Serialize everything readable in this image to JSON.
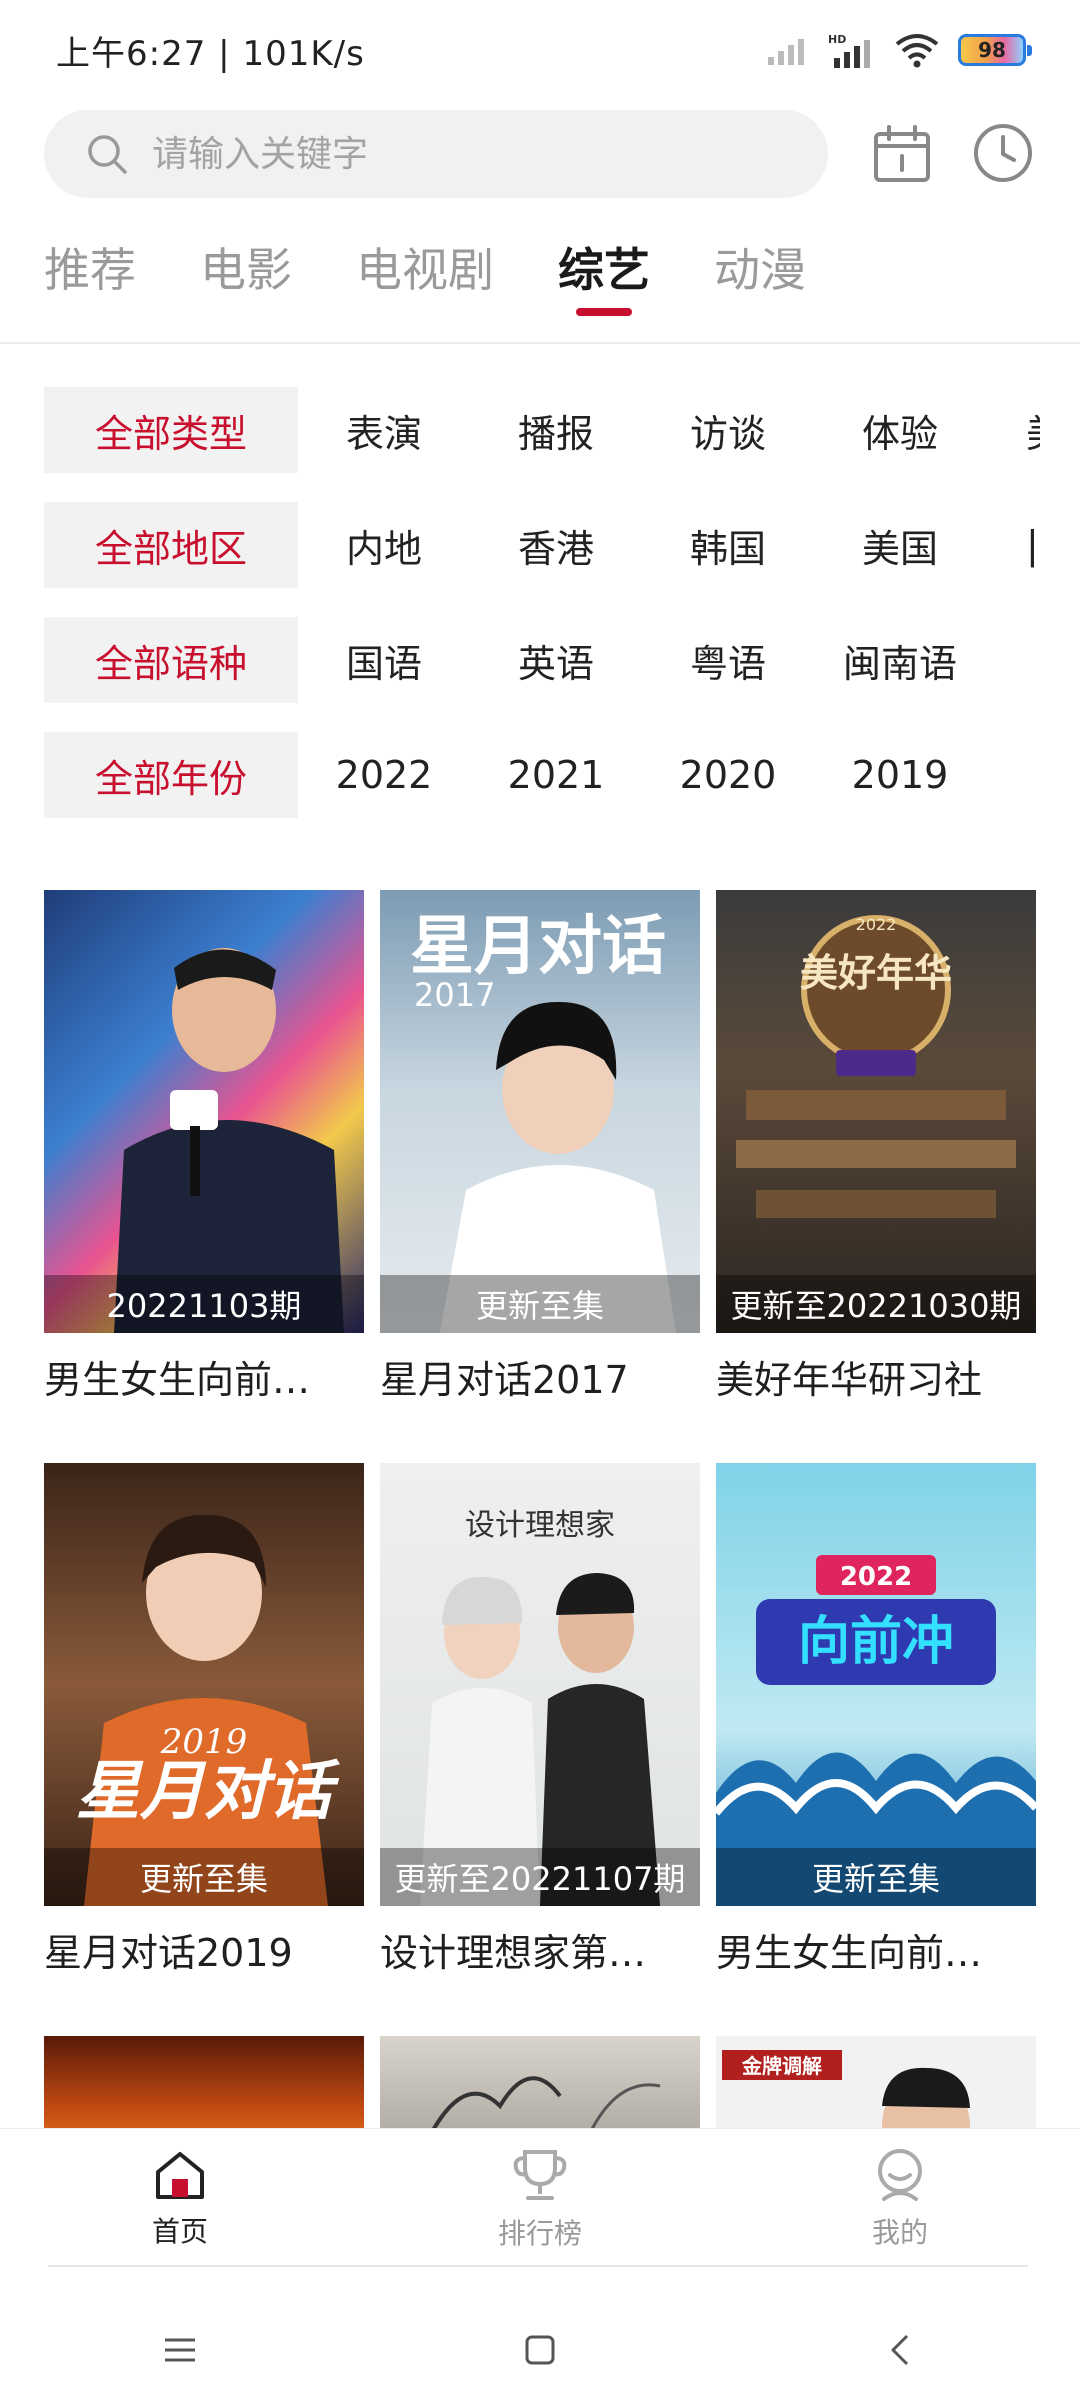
{
  "status": {
    "time": "上午6:27",
    "speed": "101K/s",
    "network_label": "HD",
    "battery": "98"
  },
  "search": {
    "placeholder": "请输入关键字"
  },
  "tabs": [
    {
      "label": "推荐",
      "active": false
    },
    {
      "label": "电影",
      "active": false
    },
    {
      "label": "电视剧",
      "active": false
    },
    {
      "label": "综艺",
      "active": true
    },
    {
      "label": "动漫",
      "active": false
    }
  ],
  "filters": [
    {
      "all": "全部类型",
      "options": [
        "表演",
        "播报",
        "访谈",
        "体验",
        "美"
      ]
    },
    {
      "all": "全部地区",
      "options": [
        "内地",
        "香港",
        "韩国",
        "美国",
        "|"
      ]
    },
    {
      "all": "全部语种",
      "options": [
        "国语",
        "英语",
        "粤语",
        "闽南语"
      ]
    },
    {
      "all": "全部年份",
      "options": [
        "2022",
        "2021",
        "2020",
        "2019"
      ]
    }
  ],
  "cards": [
    {
      "title": "男生女生向前…",
      "badge": "20221103期",
      "poster_text": "",
      "poster_year": ""
    },
    {
      "title": "星月对话2017",
      "badge": "更新至集",
      "poster_text": "星月对话",
      "poster_year": "2017"
    },
    {
      "title": "美好年华研习社",
      "badge": "更新至20221030期",
      "poster_text": "美好年华",
      "poster_year": "2022"
    },
    {
      "title": "星月对话2019",
      "badge": "更新至集",
      "poster_text": "星月对话",
      "poster_year": "2019"
    },
    {
      "title": "设计理想家第…",
      "badge": "更新至20221107期",
      "poster_text": "设计理想家",
      "poster_year": ""
    },
    {
      "title": "男生女生向前…",
      "badge": "更新至集",
      "poster_text": "向前冲",
      "poster_year": "2022"
    }
  ],
  "partial_cards": [
    {
      "poster_text": ""
    },
    {
      "poster_text": ""
    },
    {
      "poster_text": "金牌调解"
    }
  ],
  "bottom_nav": [
    {
      "label": "首页",
      "active": true
    },
    {
      "label": "排行榜",
      "active": false
    },
    {
      "label": "我的",
      "active": false
    }
  ],
  "colors": {
    "accent": "#c8102e",
    "inactive": "#999999"
  }
}
